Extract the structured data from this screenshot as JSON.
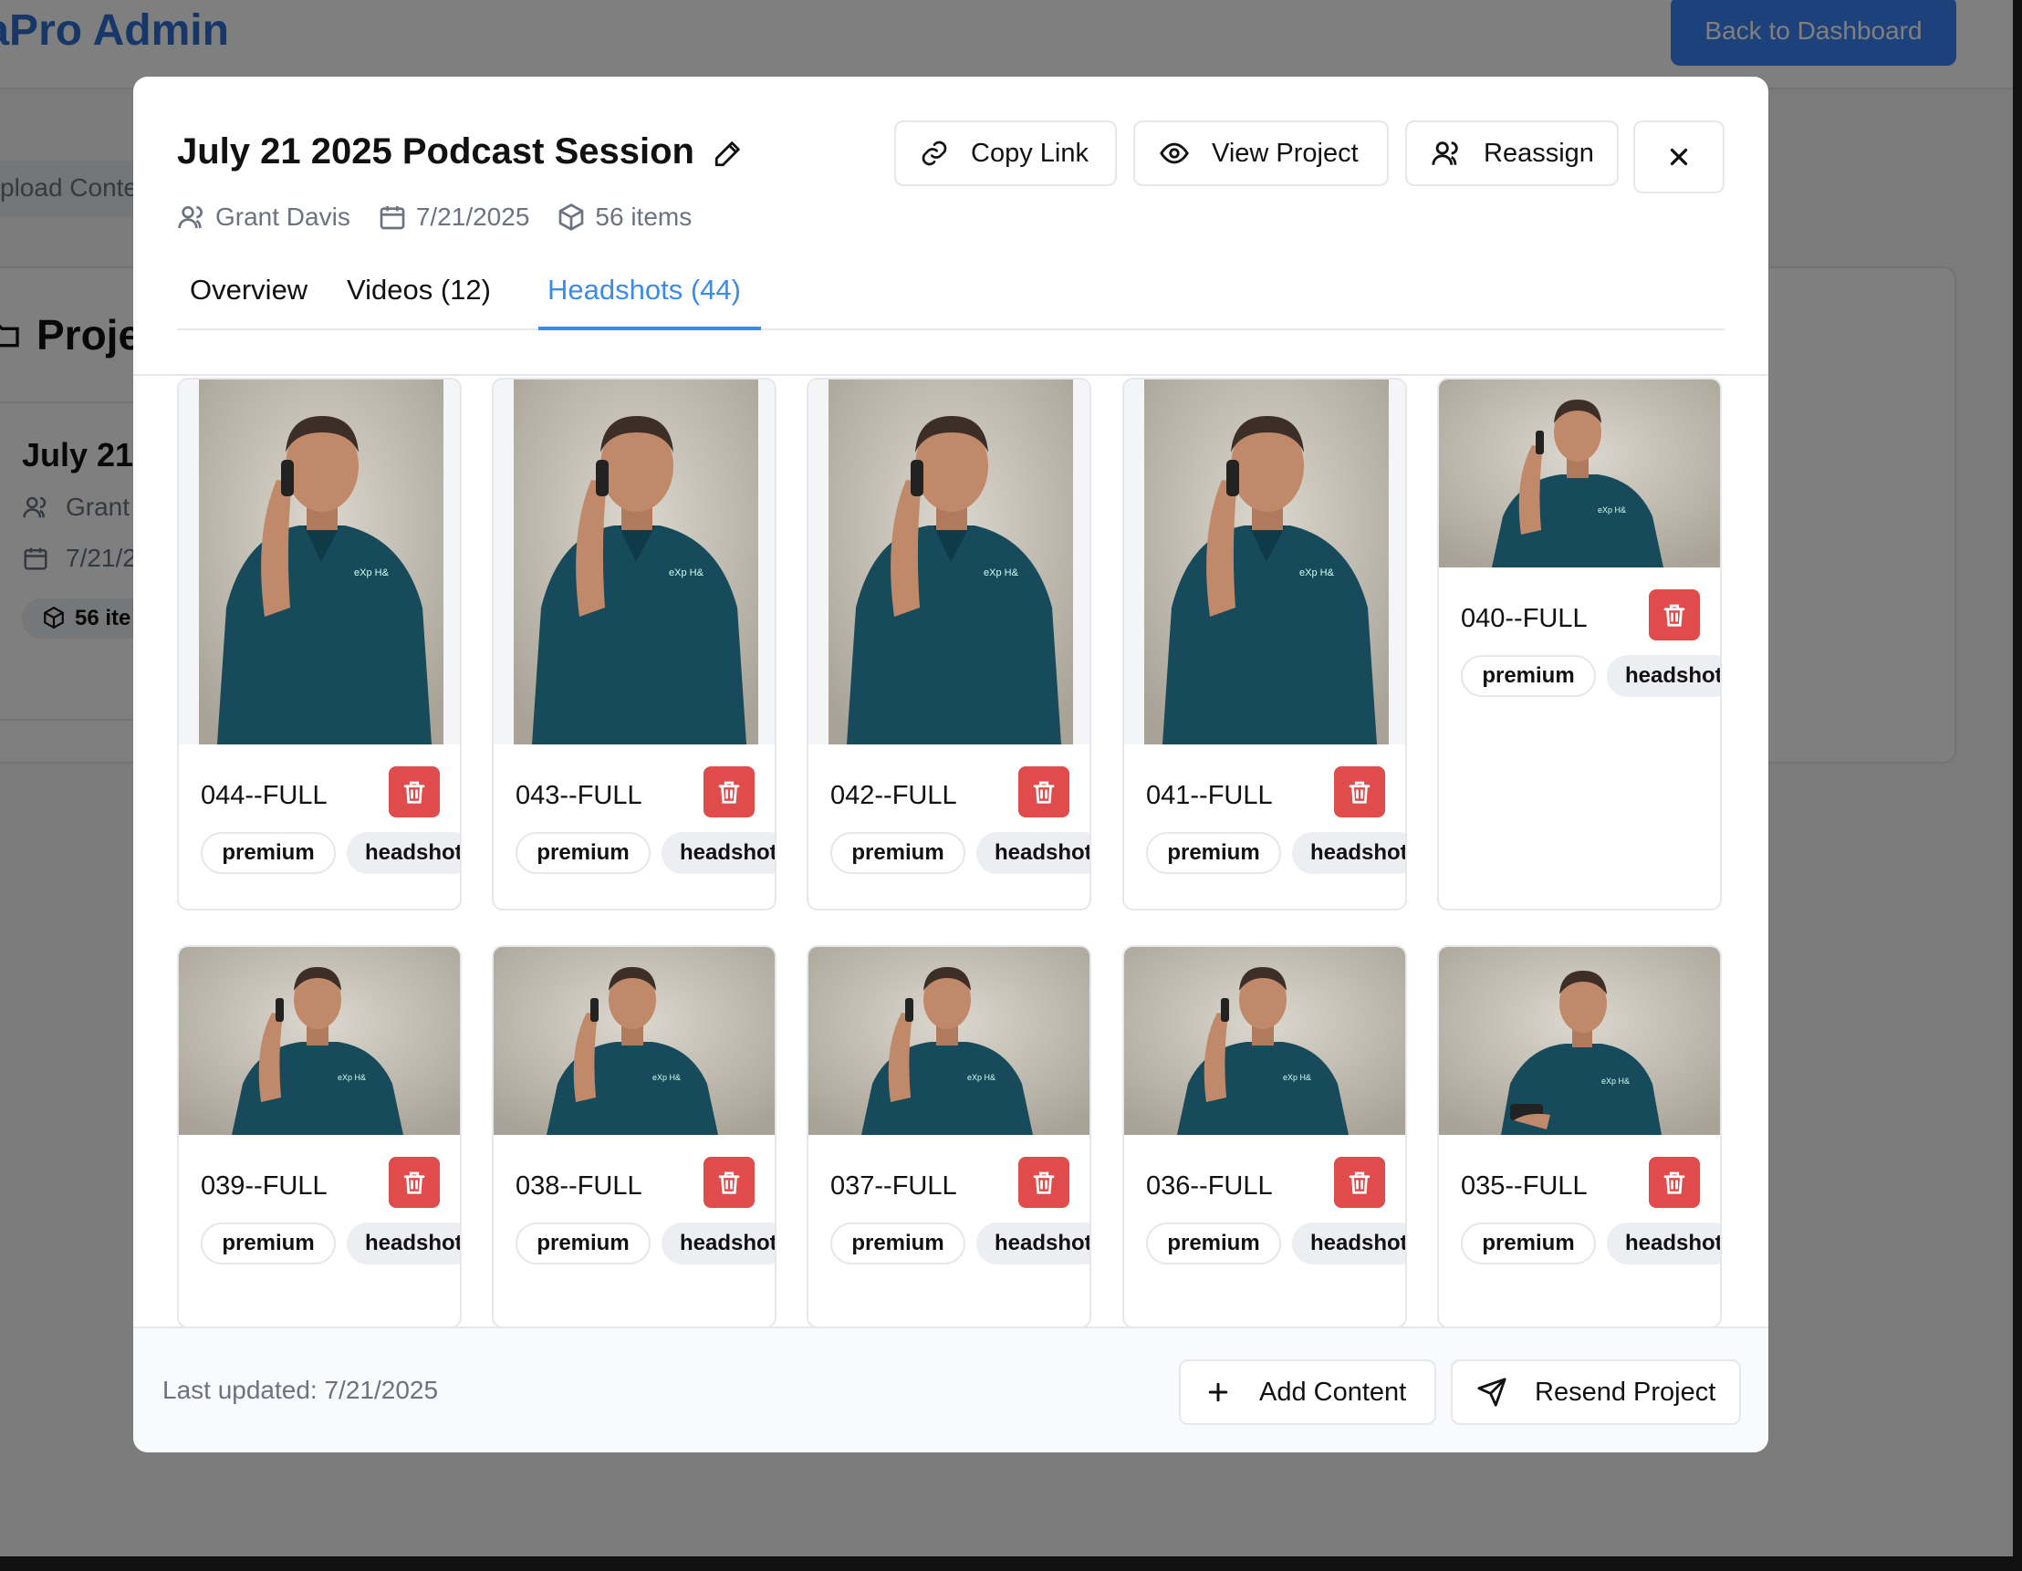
{
  "app": {
    "brand": "ediaPro Admin",
    "back_button": "Back to Dashboard",
    "upload_tab": "pload Conte",
    "projects_heading": "Proje",
    "project_card": {
      "title": "July 21",
      "owner": "Grant",
      "date": "7/21/2",
      "badge": "56 ite"
    }
  },
  "modal": {
    "title": "July 21 2025 Podcast Session",
    "meta": {
      "owner": "Grant Davis",
      "date": "7/21/2025",
      "items": "56 items"
    },
    "actions": {
      "copy_link": "Copy Link",
      "view_project": "View Project",
      "reassign": "Reassign"
    },
    "tabs": [
      {
        "label": "Overview",
        "active": false
      },
      {
        "label": "Videos (12)",
        "active": false
      },
      {
        "label": "Headshots (44)",
        "active": true
      }
    ],
    "headshots": [
      {
        "name": "044--FULL",
        "tags": [
          "premium",
          "headshot"
        ],
        "pose": "phone"
      },
      {
        "name": "043--FULL",
        "tags": [
          "premium",
          "headshot"
        ],
        "pose": "phone"
      },
      {
        "name": "042--FULL",
        "tags": [
          "premium",
          "headshot"
        ],
        "pose": "phone"
      },
      {
        "name": "041--FULL",
        "tags": [
          "premium",
          "headshot"
        ],
        "pose": "phone"
      },
      {
        "name": "040--FULL",
        "tags": [
          "premium",
          "headshot"
        ],
        "pose": "phone"
      },
      {
        "name": "039--FULL",
        "tags": [
          "premium",
          "headshot"
        ],
        "pose": "phone"
      },
      {
        "name": "038--FULL",
        "tags": [
          "premium",
          "headshot"
        ],
        "pose": "phone"
      },
      {
        "name": "037--FULL",
        "tags": [
          "premium",
          "headshot"
        ],
        "pose": "phone"
      },
      {
        "name": "036--FULL",
        "tags": [
          "premium",
          "headshot"
        ],
        "pose": "phone"
      },
      {
        "name": "035--FULL",
        "tags": [
          "premium",
          "headshot"
        ],
        "pose": "looking-down"
      }
    ],
    "footer": {
      "last_updated": "Last updated: 7/21/2025",
      "add_content": "Add Content",
      "resend_project": "Resend Project"
    }
  },
  "colors": {
    "accent": "#3b8beb",
    "brand": "#2f6fd0",
    "danger": "#e04b4b",
    "shirt": "#174a5a"
  },
  "icons": {
    "edit": "pencil-icon",
    "owner": "users-icon",
    "date": "calendar-icon",
    "items": "package-icon",
    "copy_link": "link-icon",
    "view_project": "eye-icon",
    "reassign": "users-icon",
    "close": "close-icon",
    "delete": "trash-icon",
    "add": "plus-icon",
    "resend": "send-icon"
  }
}
